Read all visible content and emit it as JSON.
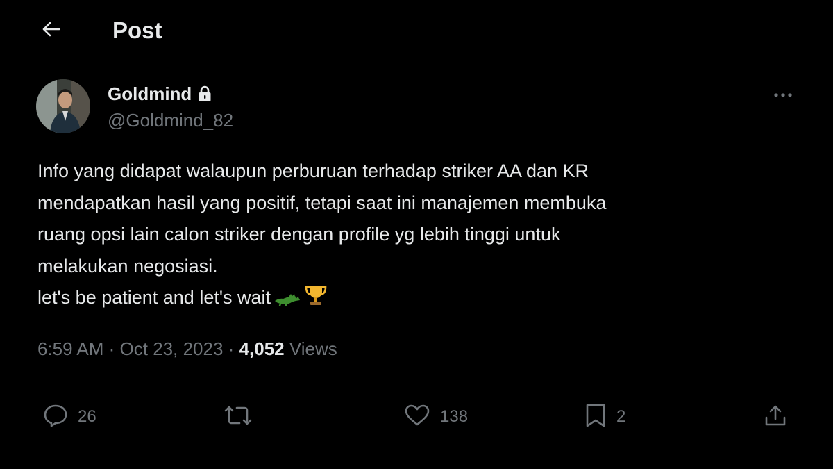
{
  "header": {
    "title": "Post",
    "back_icon": "arrow-left-icon"
  },
  "author": {
    "display_name": "Goldmind",
    "handle": "@Goldmind_82",
    "protected_icon": "lock-icon"
  },
  "tweet": {
    "lines": [
      "Info yang didapat walaupun perburuan terhadap striker AA dan KR",
      "mendapatkan hasil yang positif, tetapi saat ini manajemen membuka",
      "ruang opsi lain calon striker dengan profile yg lebih tinggi untuk",
      "melakukan negosiasi.",
      "let's be patient and let's wait"
    ],
    "emojis": [
      "crocodile-emoji",
      "trophy-emoji"
    ]
  },
  "meta": {
    "time": "6:59 AM",
    "separator": "·",
    "date": "Oct 23, 2023",
    "views_count": "4,052",
    "views_label": "Views"
  },
  "actions": {
    "replies": "26",
    "reposts": "",
    "likes": "138",
    "bookmarks": "2"
  },
  "colors": {
    "background": "#000000",
    "text_primary": "#e7e9ea",
    "text_secondary": "#71767b",
    "divider": "#2f3336"
  }
}
